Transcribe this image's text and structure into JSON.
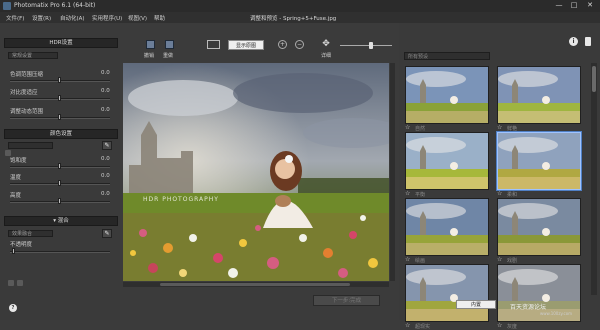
{
  "window": {
    "title": "Photomatix Pro 6.1 (64-bit)",
    "document_title": "调整和预览 - Spring+5+Fuse.jpg",
    "min_label": "—",
    "max_label": "□",
    "close_label": "✕"
  },
  "menu": [
    "文件(F)",
    "设置(R)",
    "自动化(A)",
    "实用程序(U)",
    "视图(V)",
    "帮助"
  ],
  "left_panel": {
    "sections": [
      {
        "header": "HDR设置",
        "preset": "常规设置",
        "sliders": [
          {
            "label": "色调范围压缩",
            "value": "0.0",
            "level": 0.5
          },
          {
            "label": "对比度适应",
            "value": "0.0",
            "level": 0.5
          },
          {
            "label": "调整动态范围",
            "value": "0.0",
            "level": 0.5
          }
        ]
      },
      {
        "header": "颜色设置",
        "preset": "",
        "sliders": [
          {
            "label": "饱和度",
            "value": "0.0",
            "level": 0.5
          },
          {
            "label": "温度",
            "value": "0.0",
            "level": 0.5
          },
          {
            "label": "高度",
            "value": "0.0",
            "level": 0.5
          }
        ]
      },
      {
        "header": "▾ 混合",
        "preset": "效果融合",
        "sliders": [
          {
            "label": "不透明度",
            "value": "",
            "level": 0.05
          }
        ]
      }
    ],
    "bottom_icons": [
      "undo-icon",
      "redo-icon"
    ],
    "help_label": "?"
  },
  "toolbar": {
    "buttons": [
      {
        "label": "撤销",
        "icon": "undo-icon"
      },
      {
        "label": "重做",
        "icon": "redo-icon"
      }
    ],
    "original_label": "显示原图",
    "loupe_label": "详细",
    "zoom_level": 0.6
  },
  "image": {
    "watermark_text": "HDR PHOTOGRAPHY"
  },
  "done_label": "下一步:完成",
  "right_panel": {
    "filter_placeholder": "所有预设",
    "presets": [
      {
        "label": "自然",
        "selected": false
      },
      {
        "label": "鲜艳",
        "selected": false
      },
      {
        "label": "平衡",
        "selected": false
      },
      {
        "label": "柔和",
        "selected": true
      },
      {
        "label": "绘画",
        "selected": false
      },
      {
        "label": "戏剧",
        "selected": false
      },
      {
        "label": "超现实",
        "selected": false
      },
      {
        "label": "灰度",
        "selected": false
      }
    ],
    "content_label": "内置",
    "watermark": "百天资源论坛",
    "watermark_sub": "www.100zy.com"
  },
  "colors": {
    "accent": "#4f7fc4",
    "panel": "#3a3a3a"
  }
}
